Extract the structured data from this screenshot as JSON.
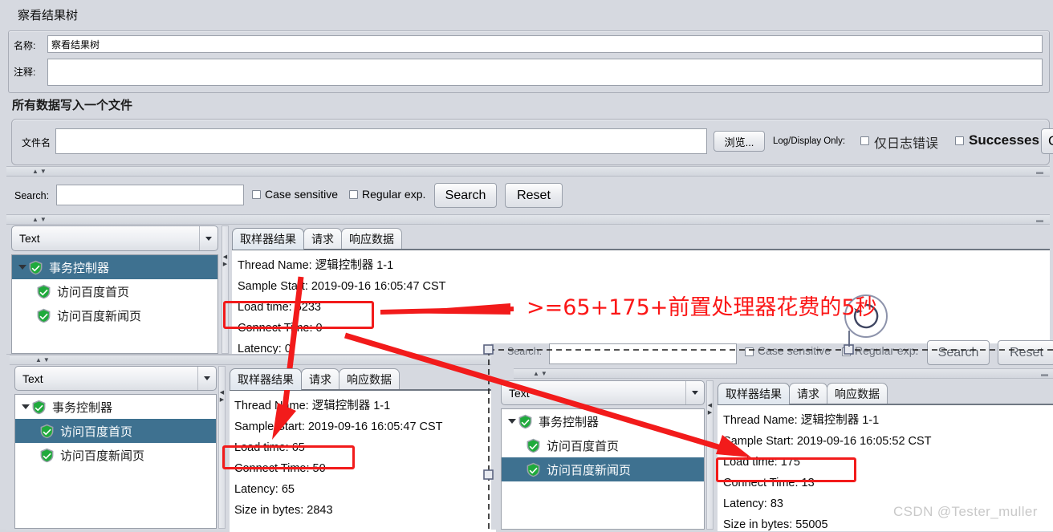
{
  "window": {
    "title": "察看结果树"
  },
  "fields": {
    "name_label": "名称:",
    "name_value": "察看结果树",
    "comment_label": "注释:",
    "comment_value": ""
  },
  "file_group": {
    "title": "所有数据写入一个文件",
    "filename_label": "文件名",
    "filename_value": "",
    "browse_button": "浏览...",
    "log_display_label": "Log/Display Only:",
    "errors_checkbox": "仅日志错误",
    "successes_checkbox": "Successes",
    "configure_button": "C"
  },
  "search_bar": {
    "label": "Search:",
    "value": "",
    "case_sensitive": "Case sensitive",
    "regular_exp": "Regular exp.",
    "search_button": "Search",
    "reset_button": "Reset"
  },
  "search_bar_2": {
    "label": "Search:",
    "value": "",
    "case_sensitive": "Case sensitive",
    "regular_exp": "Regular exp.",
    "search_button": "Search",
    "reset_button": "Reset"
  },
  "renderer": {
    "selected": "Text"
  },
  "tabs": [
    {
      "label": "取样器结果",
      "active": true
    },
    {
      "label": "请求",
      "active": false
    },
    {
      "label": "响应数据",
      "active": false
    }
  ],
  "tree": {
    "root": "事务控制器",
    "children": [
      "访问百度首页",
      "访问百度新闻页"
    ]
  },
  "panels": {
    "top": {
      "tree_selected_index": -1,
      "lines": [
        "Thread Name: 逻辑控制器 1-1",
        "Sample Start: 2019-09-16 16:05:47 CST",
        "Load time: 5233",
        "Connect Time: 0",
        "Latency: 0"
      ],
      "highlight_line": "Load time: 5233"
    },
    "bottom_left": {
      "tree_selected_index": 0,
      "lines": [
        "Thread Name: 逻辑控制器 1-1",
        "Sample Start: 2019-09-16 16:05:47 CST",
        "Load time: 65",
        "Connect Time: 50",
        "Latency: 65",
        "Size in bytes: 2843"
      ],
      "highlight_line": "Load time: 65"
    },
    "bottom_right": {
      "tree_selected_index": 1,
      "lines": [
        "Thread Name: 逻辑控制器 1-1",
        "Sample Start: 2019-09-16 16:05:52 CST",
        "Load time: 175",
        "Connect Time: 13",
        "Latency: 83",
        "Size in bytes: 55005"
      ],
      "highlight_line": "Load time: 175"
    }
  },
  "annotation": {
    "text": ">=65+175+前置处理器花费的5秒",
    "color": "#fb1717"
  },
  "watermark": "CSDN @Tester_muller",
  "colors": {
    "selection": "#3e7190",
    "annotation_red": "#fb1717",
    "panel_bg": "#d6d9e0"
  }
}
